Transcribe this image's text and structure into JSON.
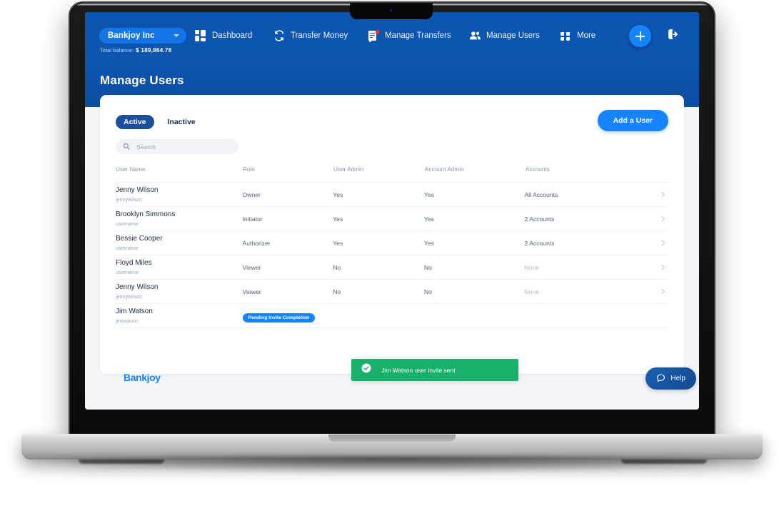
{
  "header": {
    "org_name": "Bankjoy Inc",
    "balance_label": "Total balance:",
    "balance_value": "$ 189,864.78",
    "page_title": "Manage Users",
    "nav": [
      {
        "label": "Dashboard",
        "icon": "dashboard-grid-icon"
      },
      {
        "label": "Transfer Money",
        "icon": "refresh-arrows-icon"
      },
      {
        "label": "Manage Transfers",
        "icon": "document-notification-icon"
      },
      {
        "label": "Manage Users",
        "icon": "users-icon"
      },
      {
        "label": "More",
        "icon": "four-dots-icon"
      }
    ],
    "add_icon": "plus-icon",
    "logout_icon": "logout-icon"
  },
  "toolbar": {
    "tabs": [
      {
        "label": "Active",
        "active": true
      },
      {
        "label": "Inactive",
        "active": false
      }
    ],
    "add_user_label": "Add a User",
    "search_placeholder": "Search",
    "search_value": "",
    "search_icon": "search-icon"
  },
  "table": {
    "columns": [
      "User Name",
      "Role",
      "User Admin",
      "Account Admin",
      "Accounts"
    ],
    "rows": [
      {
        "name": "Jenny Wilson",
        "handle": "jennywilson",
        "role": "Owner",
        "user_admin": "Yes",
        "account_admin": "Yes",
        "accounts": "All Accounts",
        "accounts_muted": false,
        "badge": null
      },
      {
        "name": "Brooklyn Simmons",
        "handle": "username",
        "role": "Initiator",
        "user_admin": "Yes",
        "account_admin": "Yes",
        "accounts": "2 Accounts",
        "accounts_muted": false,
        "badge": null
      },
      {
        "name": "Bessie Cooper",
        "handle": "username",
        "role": "Authorizer",
        "user_admin": "Yes",
        "account_admin": "Yes",
        "accounts": "2 Accounts",
        "accounts_muted": false,
        "badge": null
      },
      {
        "name": "Floyd Miles",
        "handle": "username",
        "role": "Viewer",
        "user_admin": "No",
        "account_admin": "No",
        "accounts": "None",
        "accounts_muted": true,
        "badge": null
      },
      {
        "name": "Jenny Wilson",
        "handle": "jennywilson",
        "role": "Viewer",
        "user_admin": "No",
        "account_admin": "No",
        "accounts": "None",
        "accounts_muted": true,
        "badge": null
      },
      {
        "name": "Jim Watson",
        "handle": "jimwatson",
        "role": "",
        "user_admin": "",
        "account_admin": "",
        "accounts": "",
        "accounts_muted": false,
        "badge": "Pending Invite Completion"
      }
    ],
    "row_chevron_icon": "chevron-right-icon"
  },
  "footer": {
    "logo_text": "Bankjoy",
    "help_label": "Help",
    "help_icon": "chat-bubble-icon"
  },
  "toast": {
    "message": "Jim Watson user invite sent",
    "icon": "check-circle-icon",
    "color": "#19b06b"
  },
  "colors": {
    "header_blue": "#0c56b3",
    "accent_blue": "#1784ff",
    "tab_active": "#1b4f9c",
    "success_green": "#19b06b",
    "notification_red": "#f8312f"
  }
}
